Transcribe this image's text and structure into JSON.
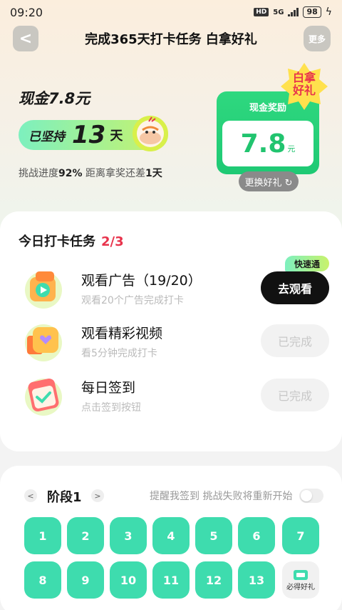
{
  "status": {
    "time": "09:20",
    "hd": "HD",
    "network": "5G",
    "battery": "98"
  },
  "nav": {
    "back": "<",
    "title": "完成365天打卡任务 白拿好礼",
    "more": "更多"
  },
  "hero": {
    "cash_title": "现金7.8元",
    "streak_pre": "已坚持",
    "streak_days": "13",
    "streak_post": "天",
    "progress_prefix": "挑战进度",
    "progress_pct": "92%",
    "progress_mid": " 距离拿奖还差",
    "progress_left": "1天"
  },
  "reward": {
    "label": "现金奖励",
    "amount": "7.8",
    "unit": "元",
    "badge_line1": "白拿",
    "badge_line2": "好礼",
    "change": "更换好礼 ↻"
  },
  "tasks": {
    "header": "今日打卡任务",
    "count": "2/3",
    "fast_tag": "快速通",
    "items": [
      {
        "title": "观看广告（19/20）",
        "sub": "观看20个广告完成打卡",
        "button": "去观看"
      },
      {
        "title": "观看精彩视频",
        "sub": "看5分钟完成打卡",
        "button": "已完成"
      },
      {
        "title": "每日签到",
        "sub": "点击签到按钮",
        "button": "已完成"
      }
    ]
  },
  "stage": {
    "title": "阶段1",
    "prev": "<",
    "next": ">",
    "remind": "提醒我签到 挑战失败将重新开始",
    "days": [
      "1",
      "2",
      "3",
      "4",
      "5",
      "6",
      "7",
      "8",
      "9",
      "10",
      "11",
      "12",
      "13"
    ],
    "gift_label": "必得好礼"
  },
  "colors": {
    "accent": "#1ec974",
    "day_tile": "#3edcae",
    "highlight": "#e8334c"
  }
}
